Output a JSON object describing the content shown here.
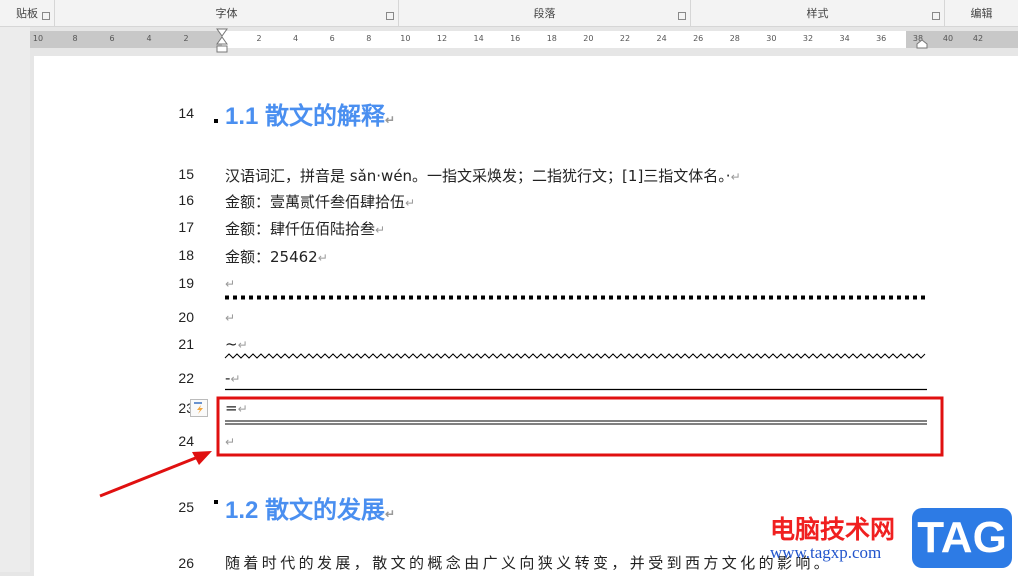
{
  "ribbon": {
    "groups": [
      "贴板",
      "字体",
      "段落",
      "样式",
      "编辑"
    ]
  },
  "ruler": {
    "left": [
      "10",
      "8",
      "6",
      "4",
      "2"
    ],
    "main": [
      "2",
      "4",
      "6",
      "8",
      "10",
      "12",
      "14",
      "16",
      "18",
      "20",
      "22",
      "24",
      "26",
      "28",
      "30",
      "32",
      "34",
      "36"
    ],
    "right": [
      "38",
      "40",
      "42"
    ]
  },
  "doc": {
    "heading1": {
      "num": "14",
      "text": "1.1 散文的解释"
    },
    "lines": [
      {
        "num": "15",
        "text": "汉语词汇，拼音是 sǎn·wén。一指文采焕发；二指犹行文；[1]三指文体名。·"
      },
      {
        "num": "16",
        "text": "金额：壹萬贰仟叁佰肆拾伍"
      },
      {
        "num": "17",
        "text": "金额：肆仟伍佰陆拾叁"
      },
      {
        "num": "18",
        "text": "金额：25462"
      },
      {
        "num": "19",
        "text": ""
      },
      {
        "num": "20",
        "text": ""
      },
      {
        "num": "21",
        "text": "~"
      },
      {
        "num": "22",
        "text": "-"
      },
      {
        "num": "23",
        "text": "="
      },
      {
        "num": "24",
        "text": ""
      }
    ],
    "heading2": {
      "num": "25",
      "text": "1.2 散文的发展"
    },
    "line26": {
      "num": "26",
      "text": "随着时代的发展，散文的概念由广义向狭义转变，并受到西方文化的影响。"
    },
    "para_mark": "↵"
  },
  "watermark": {
    "site": "电脑技术网",
    "url": "www.tagxp.com",
    "logo": "TAG"
  },
  "colors": {
    "heading": "#4a8ff0",
    "highlight": "#e01010"
  }
}
